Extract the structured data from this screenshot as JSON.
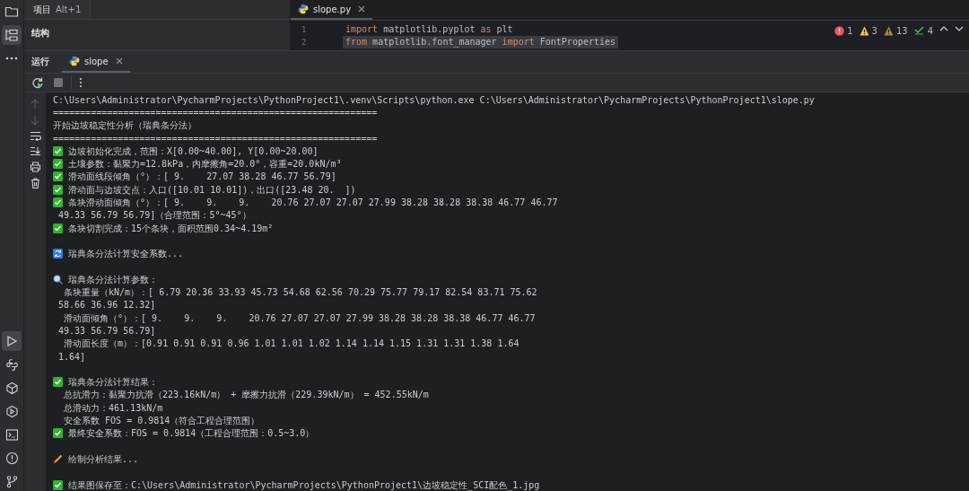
{
  "project_tab": {
    "label": "项目",
    "shortcut": "Alt+1"
  },
  "structure_title": "结构",
  "editor": {
    "tabs": [
      {
        "label": "slope.py",
        "selected": true
      }
    ],
    "lines": [
      {
        "number": "1",
        "highlighted": false,
        "tokens": [
          {
            "kind": "keyword",
            "text": "import"
          },
          {
            "kind": "plain",
            "text": " matplotlib.pyplot "
          },
          {
            "kind": "keyword",
            "text": "as"
          },
          {
            "kind": "plain",
            "text": " plt"
          }
        ]
      },
      {
        "number": "2",
        "highlighted": true,
        "tokens": [
          {
            "kind": "keyword",
            "text": "from"
          },
          {
            "kind": "plain",
            "text": " matplotlib.font_manager "
          },
          {
            "kind": "keyword",
            "text": "import"
          },
          {
            "kind": "plain",
            "text": " FontProperties"
          }
        ]
      }
    ],
    "inspections": [
      {
        "kind": "error",
        "count": "1"
      },
      {
        "kind": "warning",
        "count": "3"
      },
      {
        "kind": "weak",
        "count": "13"
      },
      {
        "kind": "typo",
        "count": "4"
      }
    ]
  },
  "run_panel": {
    "title": "运行",
    "tabs": [
      {
        "label": "slope",
        "selected": true
      }
    ],
    "console": [
      {
        "kind": "text",
        "text": "C:\\Users\\Administrator\\PycharmProjects\\PythonProject1\\.venv\\Scripts\\python.exe C:\\Users\\Administrator\\PycharmProjects\\PythonProject1\\slope.py"
      },
      {
        "kind": "text",
        "text": "============================================================"
      },
      {
        "kind": "text",
        "text": "开始边坡稳定性分析（瑞典条分法）"
      },
      {
        "kind": "text",
        "text": "============================================================"
      },
      {
        "kind": "check",
        "text": "边坡初始化完成，范围：X[0.00~40.00], Y[0.00~20.00]"
      },
      {
        "kind": "check",
        "text": "土壤参数：黏聚力=12.8kPa，内摩擦角=20.0°，容重=20.0kN/m³"
      },
      {
        "kind": "check",
        "text": "滑动面线段倾角（°）：[ 9.    27.07 38.28 46.77 56.79]"
      },
      {
        "kind": "check",
        "text": "滑动面与边坡交点：入口([10.01 10.01])，出口([23.48 20.  ])"
      },
      {
        "kind": "check",
        "text": "条块滑动面倾角（°）：[ 9.    9.    9.    20.76 27.07 27.07 27.99 38.28 38.28 38.38 46.77 46.77"
      },
      {
        "kind": "text",
        "text": " 49.33 56.79 56.79]（合理范围：5°~45°）"
      },
      {
        "kind": "check",
        "text": "条块切割完成：15个条块，面积范围0.34~4.19m²"
      },
      {
        "kind": "blank"
      },
      {
        "kind": "sync",
        "text": "瑞典条分法计算安全系数..."
      },
      {
        "kind": "blank"
      },
      {
        "kind": "search",
        "text": "瑞典条分法计算参数："
      },
      {
        "kind": "text",
        "text": "  条块重量（kN/m）：[ 6.79 20.36 33.93 45.73 54.68 62.56 70.29 75.77 79.17 82.54 83.71 75.62"
      },
      {
        "kind": "text",
        "text": " 58.66 36.96 12.32]"
      },
      {
        "kind": "text",
        "text": "  滑动面倾角（°）：[ 9.    9.    9.    20.76 27.07 27.07 27.99 38.28 38.28 38.38 46.77 46.77"
      },
      {
        "kind": "text",
        "text": " 49.33 56.79 56.79]"
      },
      {
        "kind": "text",
        "text": "  滑动面长度（m）：[0.91 0.91 0.91 0.96 1.01 1.01 1.02 1.14 1.14 1.15 1.31 1.31 1.38 1.64"
      },
      {
        "kind": "text",
        "text": " 1.64]"
      },
      {
        "kind": "blank"
      },
      {
        "kind": "check",
        "text": "瑞典条分法计算结果："
      },
      {
        "kind": "text",
        "text": "  总抗滑力：黏聚力抗滑（223.16kN/m） + 摩擦力抗滑（229.39kN/m） = 452.55kN/m"
      },
      {
        "kind": "text",
        "text": "  总滑动力：461.13kN/m"
      },
      {
        "kind": "text",
        "text": "  安全系数 FOS = 0.9814（符合工程合理范围）"
      },
      {
        "kind": "check",
        "text": "最终安全系数：FOS = 0.9814（工程合理范围：0.5~3.0）"
      },
      {
        "kind": "blank"
      },
      {
        "kind": "pencil",
        "text": "绘制分析结果..."
      },
      {
        "kind": "blank"
      },
      {
        "kind": "check",
        "text": "结果图保存至：C:\\Users\\Administrator\\PycharmProjects\\PythonProject1\\边坡稳定性_SCI配色_1.jpg"
      }
    ]
  }
}
